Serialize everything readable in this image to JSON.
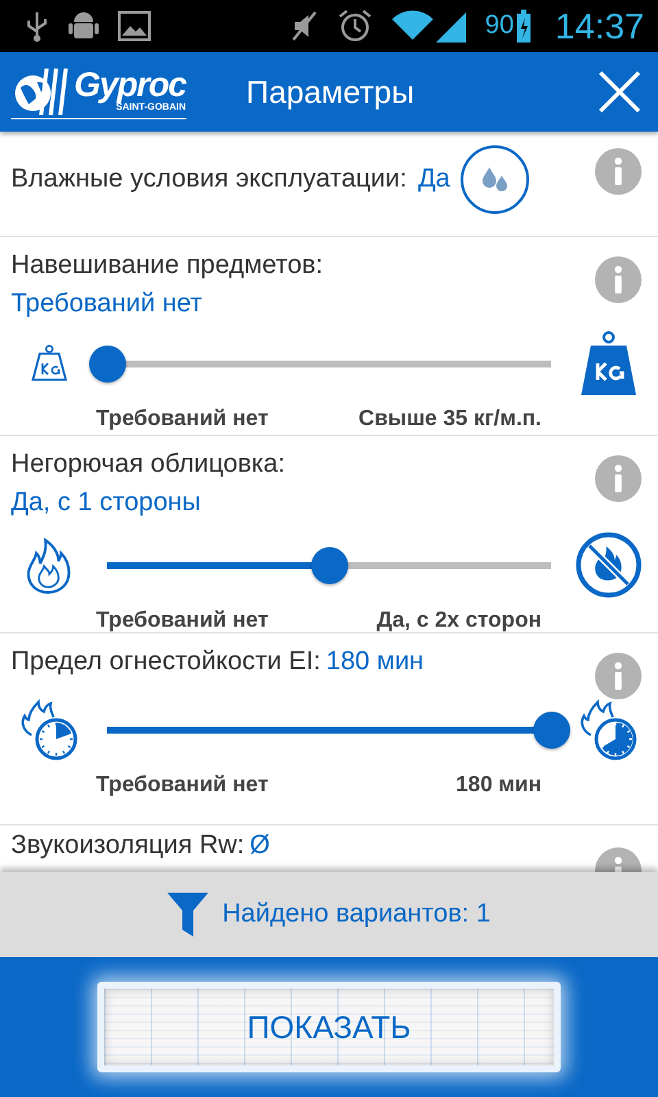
{
  "status_bar": {
    "battery": "90",
    "time": "14:37"
  },
  "app_bar": {
    "logo": "Gyproc",
    "logo_sub": "SAINT-GOBAIN",
    "title": "Параметры"
  },
  "rows": [
    {
      "kind": "toggle",
      "label": "Влажные условия эксплуатации:",
      "value": "Да"
    },
    {
      "kind": "slider",
      "label": "Навешивание предметов:",
      "value": "Требований нет",
      "level": 0,
      "min_label": "Требований нет",
      "max_label": "Свыше 35 кг/м.п."
    },
    {
      "kind": "slider",
      "label": "Негорючая облицовка:",
      "value": "Да, с 1 стороны",
      "level": 0.5,
      "min_label": "Требований нет",
      "max_label": "Да, с 2х сторон"
    },
    {
      "kind": "slider_inline",
      "label": "Предел огнестойкости EI:",
      "value": "180 мин",
      "level": 1,
      "min_label": "Требований нет",
      "max_label": "180 мин"
    },
    {
      "kind": "partial",
      "label": "Звукоизоляция Rw:",
      "value": "Ø"
    }
  ],
  "filter_bar": {
    "text": "Найдено вариантов: 1"
  },
  "show_button": {
    "label": "ПОКАЗАТЬ"
  }
}
